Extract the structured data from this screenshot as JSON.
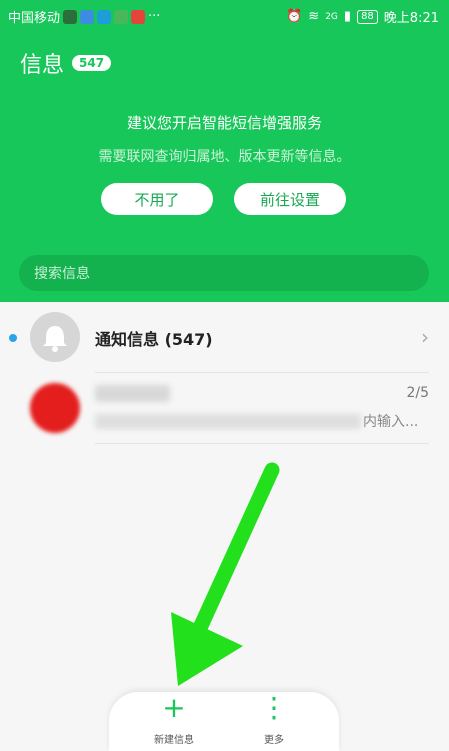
{
  "status_bar": {
    "carrier": "中国移动",
    "more_dots": "···",
    "net_type": "2G",
    "battery": "88",
    "time": "晚上8:21"
  },
  "header": {
    "title": "信息",
    "count": "547"
  },
  "suggestion": {
    "line1": "建议您开启智能短信增强服务",
    "line2": "需要联网查询归属地、版本更新等信息。",
    "dismiss_label": "不用了",
    "settings_label": "前往设置"
  },
  "search": {
    "placeholder": "搜索信息"
  },
  "conversations": [
    {
      "name": "通知信息 (547)"
    },
    {
      "preview_tail": "内输入...",
      "page_count": "2/5"
    }
  ],
  "bottom_nav": {
    "new_label": "新建信息",
    "more_label": "更多"
  },
  "colors": {
    "brand_green": "#18c75a",
    "annotation_arrow": "#22e01b"
  }
}
